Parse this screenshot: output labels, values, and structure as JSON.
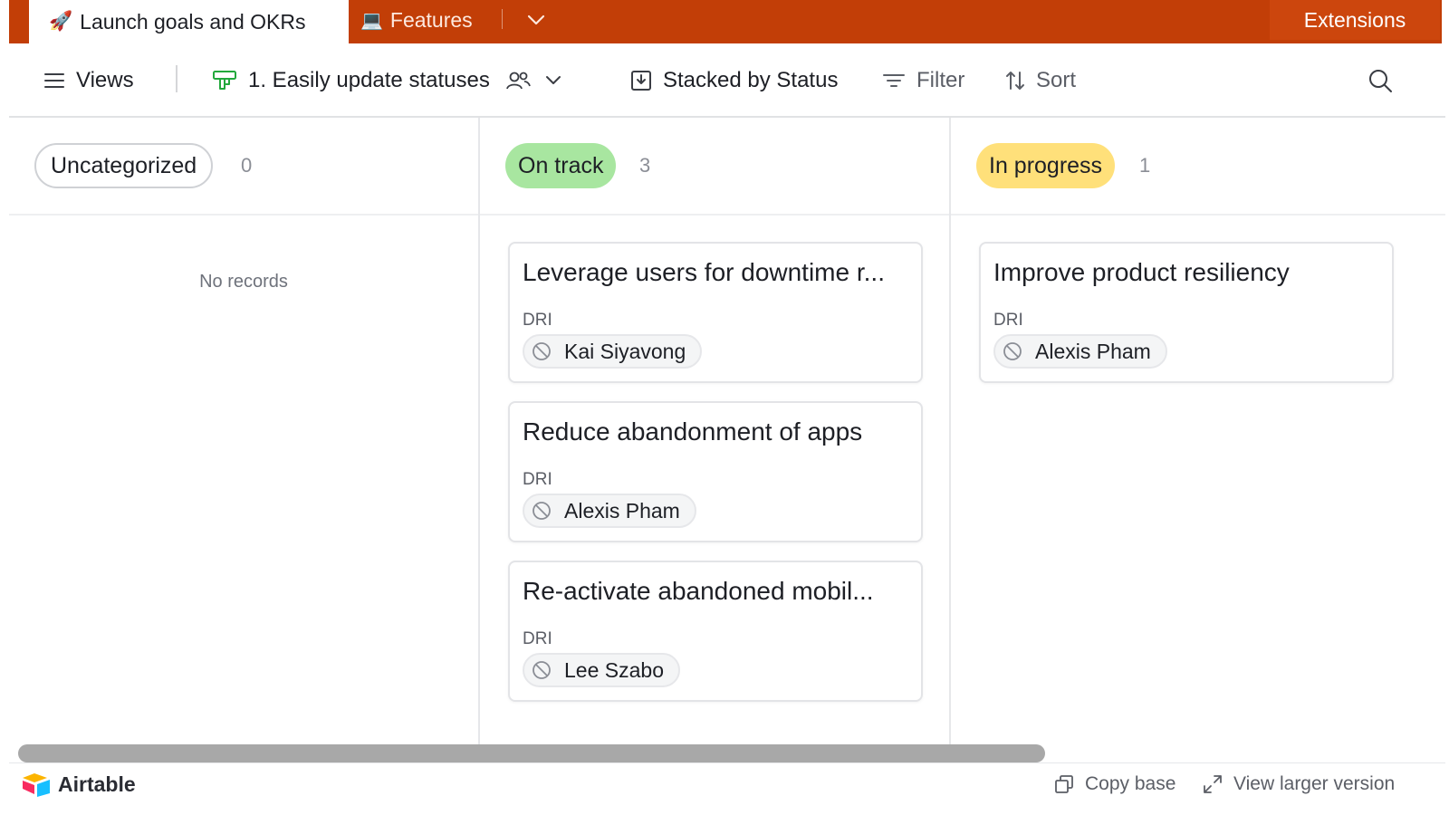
{
  "tabs": {
    "active": {
      "emoji": "🚀",
      "label": "Launch goals and OKRs"
    },
    "features": {
      "emoji": "💻",
      "label": "Features"
    },
    "extensions_label": "Extensions"
  },
  "toolbar": {
    "views_label": "Views",
    "view_name": "1. Easily update statuses",
    "stacked_label": "Stacked by Status",
    "filter_label": "Filter",
    "sort_label": "Sort"
  },
  "columns": [
    {
      "status": "Uncategorized",
      "count": "0",
      "empty_text": "No records",
      "color": "#ffffff"
    },
    {
      "status": "On track",
      "count": "3",
      "color": "#a8e6a0"
    },
    {
      "status": "In progress",
      "count": "1",
      "color": "#ffe07a"
    }
  ],
  "cards": {
    "on_track": [
      {
        "title": "Leverage users for downtime r...",
        "field_label": "DRI",
        "person": "Kai Siyavong"
      },
      {
        "title": "Reduce abandonment of apps",
        "field_label": "DRI",
        "person": "Alexis Pham"
      },
      {
        "title": "Re-activate abandoned mobil...",
        "field_label": "DRI",
        "person": "Lee Szabo"
      }
    ],
    "in_progress": [
      {
        "title": "Improve product resiliency",
        "field_label": "DRI",
        "person": "Alexis Pham"
      }
    ]
  },
  "footer": {
    "brand": "Airtable",
    "copy_label": "Copy base",
    "view_larger_label": "View larger version"
  },
  "colors": {
    "tab_bar": "#c23e07",
    "extensions_bg": "#cc460d",
    "accent_green": "#22a83c"
  }
}
